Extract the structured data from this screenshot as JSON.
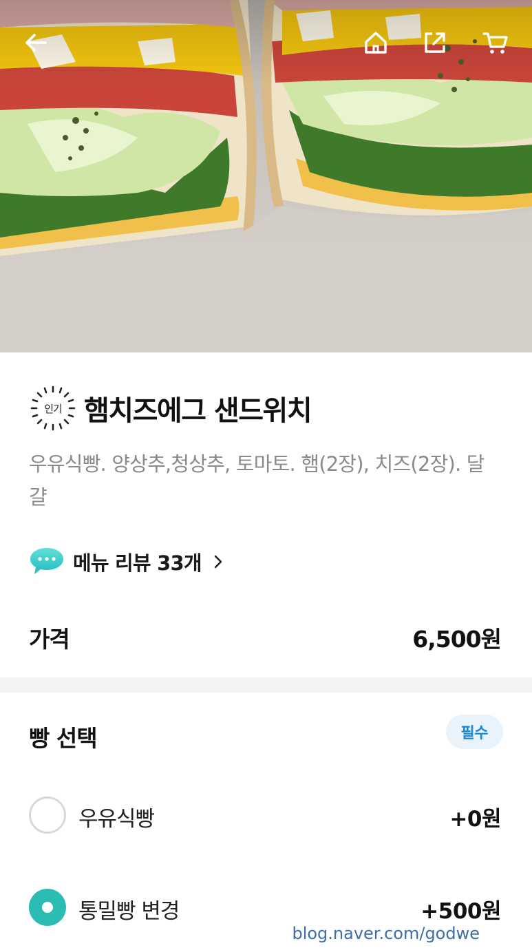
{
  "menu": {
    "badge_label": "인기",
    "title": "햄치즈에그 샌드위치",
    "description": "우유식빵. 양상추,청상추, 토마토. 햄(2장), 치즈(2장). 달걀",
    "review_link": "메뉴 리뷰 33개",
    "price_label": "가격",
    "price_value": "6,500원"
  },
  "options_group": {
    "title": "빵 선택",
    "required_badge": "필수",
    "items": [
      {
        "name": "우유식빵",
        "price": "+0원",
        "selected": false
      },
      {
        "name": "통밀빵 변경",
        "price": "+500원",
        "selected": true
      }
    ]
  },
  "watermark": "blog.naver.com/godwe",
  "icons": {
    "back": "arrow-left-icon",
    "home": "home-icon",
    "share": "share-icon",
    "cart": "cart-icon",
    "review": "chat-bubble-icon",
    "chevron": "chevron-right-icon"
  },
  "colors": {
    "accent_teal": "#2bbcb4",
    "badge_blue": "#1e86d8",
    "badge_bg": "#e8f3fc",
    "divider": "#f1f3f5"
  }
}
